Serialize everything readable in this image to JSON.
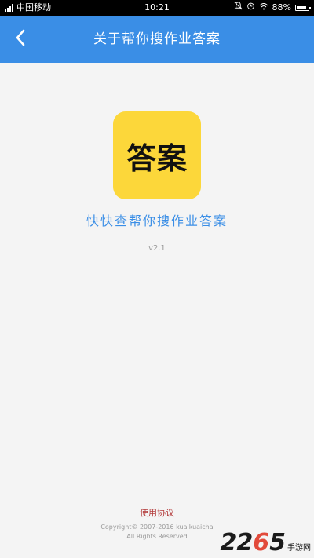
{
  "status_bar": {
    "carrier": "中国移动",
    "time": "10:21",
    "battery": "88%",
    "battery_level": 0.88
  },
  "header": {
    "title": "关于帮你搜作业答案"
  },
  "app": {
    "icon_text": "答案",
    "name": "快快查帮你搜作业答案",
    "version": "v2.1"
  },
  "footer": {
    "agreement": "使用协议",
    "copyright_line1": "Copyright© 2007-2016 kuaikuaicha",
    "copyright_line2": "All Rights Reserved"
  },
  "watermark": {
    "number_a": "22",
    "number_accent": "6",
    "number_b": "5",
    "text": "手游网"
  },
  "colors": {
    "header": "#3a8ee6",
    "icon_bg": "#fcd73a",
    "agreement": "#b33b3b"
  }
}
